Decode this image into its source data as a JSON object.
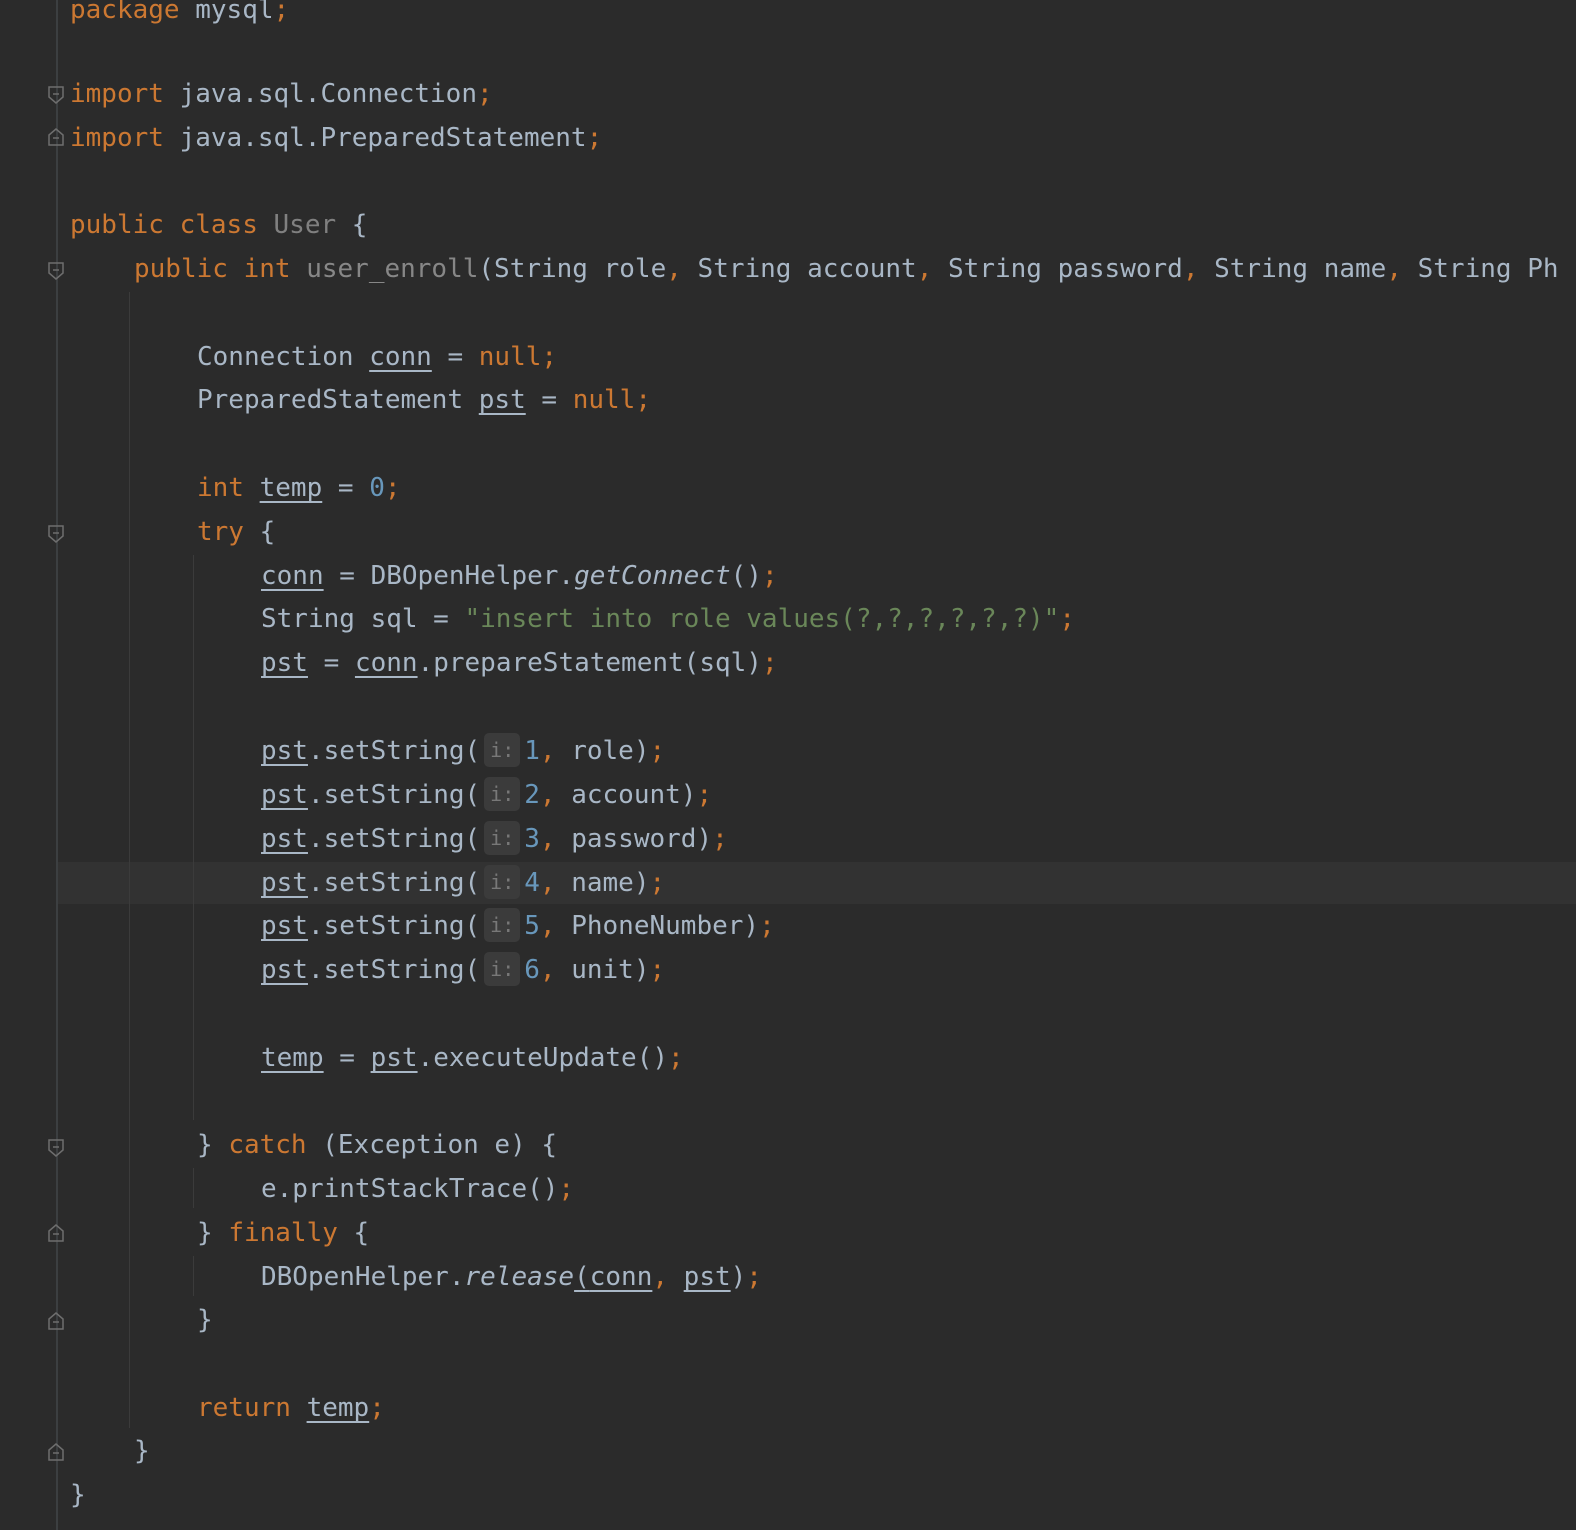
{
  "editor": {
    "lines": {
      "l1": {
        "kw": "package",
        "rest": " mysql",
        "semi": ";"
      },
      "l2": {
        "kw": "import",
        "rest": " java.sql.Connection",
        "semi": ";"
      },
      "l3": {
        "kw": "import",
        "rest": " java.sql.PreparedStatement",
        "semi": ";"
      },
      "l4": {
        "kw1": "public",
        "kw2": "class",
        "name": "User",
        "brace": " {"
      },
      "l5": {
        "kw1": "public",
        "kw2": "int",
        "name": "user_enroll",
        "p1": "(String role",
        "c1": ",",
        "p2": " String account",
        "c2": ",",
        "p3": " String password",
        "c3": ",",
        "p4": " String name",
        "c4": ",",
        "p5": " String Ph"
      },
      "l6": {
        "type": "Connection ",
        "var": "conn",
        "eq": " = ",
        "val": "null",
        "semi": ";"
      },
      "l7": {
        "type": "PreparedStatement ",
        "var": "pst",
        "eq": " = ",
        "val": "null",
        "semi": ";"
      },
      "l8": {
        "kw": "int",
        "var": "temp",
        "eq": " = ",
        "num": "0",
        "semi": ";"
      },
      "l9": {
        "kw": "try",
        "brace": " {"
      },
      "l10": {
        "var": "conn",
        "eq": " = DBOpenHelper.",
        "method": "getConnect",
        "paren": "()",
        "semi": ";"
      },
      "l11": {
        "pre": "String sql = ",
        "str": "\"insert into role values(?,?,?,?,?,?)\"",
        "semi": ";"
      },
      "l12": {
        "var": "pst",
        "eq": " = ",
        "var2": "conn",
        "rest": ".prepareStatement(sql)",
        "semi": ";"
      },
      "l13": {
        "var": "pst",
        "call": ".setString(",
        "hint": "i:",
        "num": "1",
        "comma": ",",
        "arg": " role)",
        "semi": ";"
      },
      "l14": {
        "var": "pst",
        "call": ".setString(",
        "hint": "i:",
        "num": "2",
        "comma": ",",
        "arg": " account)",
        "semi": ";"
      },
      "l15": {
        "var": "pst",
        "call": ".setString(",
        "hint": "i:",
        "num": "3",
        "comma": ",",
        "arg": " password)",
        "semi": ";"
      },
      "l16": {
        "var": "pst",
        "call": ".setString(",
        "hint": "i:",
        "num": "4",
        "comma": ",",
        "arg": " name)",
        "semi": ";"
      },
      "l17": {
        "var": "pst",
        "call": ".setString(",
        "hint": "i:",
        "num": "5",
        "comma": ",",
        "arg": " PhoneNumber)",
        "semi": ";"
      },
      "l18": {
        "var": "pst",
        "call": ".setString(",
        "hint": "i:",
        "num": "6",
        "comma": ",",
        "arg": " unit)",
        "semi": ";"
      },
      "l19": {
        "var": "temp",
        "eq": " = ",
        "var2": "pst",
        "rest": ".executeUpdate()",
        "semi": ";"
      },
      "l20": {
        "pre": "} ",
        "kw": "catch",
        "rest": " (Exception e) {"
      },
      "l21": {
        "rest": "e.printStackTrace()",
        "semi": ";"
      },
      "l22": {
        "pre": "} ",
        "kw": "finally",
        "rest": " {"
      },
      "l23": {
        "pre": "DBOpenHelper.",
        "method": "release",
        "open": "(",
        "v1": "conn",
        "comma": ",",
        "sp": " ",
        "v2": "pst",
        "close": ")",
        "semi": ";"
      },
      "l24": {
        "rest": "}"
      },
      "l25": {
        "kw": "return",
        "sp": " ",
        "var": "temp",
        "semi": ";"
      },
      "l26": {
        "rest": "}"
      },
      "l27": {
        "rest": "}"
      }
    }
  }
}
